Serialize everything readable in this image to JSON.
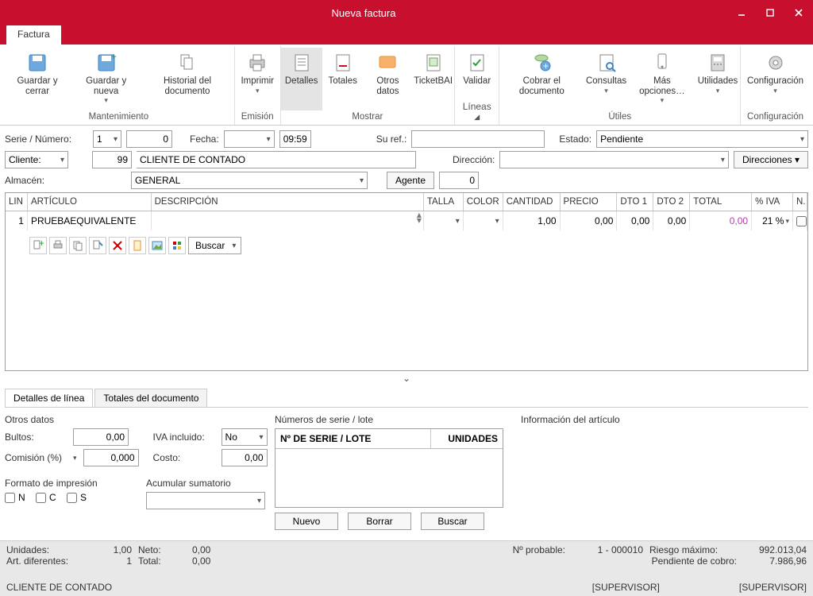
{
  "window": {
    "title": "Nueva factura"
  },
  "tabs": {
    "factura": "Factura"
  },
  "ribbon": {
    "guardar_cerrar": "Guardar y cerrar",
    "guardar_nueva": "Guardar y nueva",
    "historial": "Historial del documento",
    "grp_mantenimiento": "Mantenimiento",
    "imprimir": "Imprimir",
    "grp_emision": "Emisión",
    "detalles": "Detalles",
    "totales": "Totales",
    "otros_datos": "Otros datos",
    "ticketbai": "TicketBAI",
    "grp_mostrar": "Mostrar",
    "validar": "Validar",
    "grp_lineas": "Líneas",
    "cobrar": "Cobrar el documento",
    "consultas": "Consultas",
    "mas_opciones": "Más opciones…",
    "utilidades": "Utilidades",
    "grp_utiles": "Útiles",
    "configuracion": "Configuración",
    "grp_configuracion": "Configuración"
  },
  "form": {
    "serie_numero_lbl": "Serie / Número:",
    "serie_val": "1",
    "numero_val": "0",
    "fecha_lbl": "Fecha:",
    "hora_val": "09:59",
    "su_ref_lbl": "Su ref.:",
    "estado_lbl": "Estado:",
    "estado_val": "Pendiente",
    "cliente_lbl": "Cliente:",
    "cliente_num": "99",
    "cliente_nombre": "CLIENTE DE CONTADO",
    "direccion_lbl": "Dirección:",
    "direcciones_btn": "Direcciones",
    "almacen_lbl": "Almacén:",
    "almacen_val": "GENERAL",
    "agente_btn": "Agente",
    "agente_val": "0"
  },
  "grid": {
    "h_lin": "LIN",
    "h_art": "ARTÍCULO",
    "h_desc": "DESCRIPCIÓN",
    "h_talla": "TALLA",
    "h_color": "COLOR",
    "h_cant": "CANTIDAD",
    "h_precio": "PRECIO",
    "h_dto1": "DTO 1",
    "h_dto2": "DTO 2",
    "h_total": "TOTAL",
    "h_iva": "% IVA",
    "h_n": "N.",
    "rows": [
      {
        "lin": "1",
        "articulo": "PRUEBAEQUIVALENTE",
        "descripcion": "",
        "talla": "",
        "color": "",
        "cantidad": "1,00",
        "precio": "0,00",
        "dto1": "0,00",
        "dto2": "0,00",
        "total": "0,00",
        "iva": "21 %"
      }
    ],
    "buscar": "Buscar"
  },
  "detail_tabs": {
    "linea": "Detalles de línea",
    "totales": "Totales del documento"
  },
  "otros": {
    "title": "Otros datos",
    "bultos_lbl": "Bultos:",
    "bultos_val": "0,00",
    "comision_lbl": "Comisión (%)",
    "comision_val": "0,000",
    "iva_inc_lbl": "IVA incluido:",
    "iva_inc_val": "No",
    "costo_lbl": "Costo:",
    "costo_val": "0,00",
    "formato_title": "Formato de impresión",
    "chk_n": "N",
    "chk_c": "C",
    "chk_s": "S",
    "acum_title": "Acumular sumatorio"
  },
  "serie": {
    "title": "Números de serie / lote",
    "h1": "Nº DE SERIE / LOTE",
    "h2": "UNIDADES",
    "nuevo": "Nuevo",
    "borrar": "Borrar",
    "buscar": "Buscar"
  },
  "info_art": {
    "title": "Información del artículo"
  },
  "status": {
    "unidades_lbl": "Unidades:",
    "unidades_val": "1,00",
    "neto_lbl": "Neto:",
    "neto_val": "0,00",
    "art_dif_lbl": "Art. diferentes:",
    "art_dif_val": "1",
    "total_lbl": "Total:",
    "total_val": "0,00",
    "n_probable_lbl": "Nº probable:",
    "n_probable_val": "1 - 000010",
    "riesgo_lbl": "Riesgo máximo:",
    "riesgo_val": "992.013,04",
    "pendiente_lbl": "Pendiente de cobro:",
    "pendiente_val": "7.986,96",
    "cliente": "CLIENTE DE CONTADO",
    "sup1": "[SUPERVISOR]",
    "sup2": "[SUPERVISOR]"
  }
}
